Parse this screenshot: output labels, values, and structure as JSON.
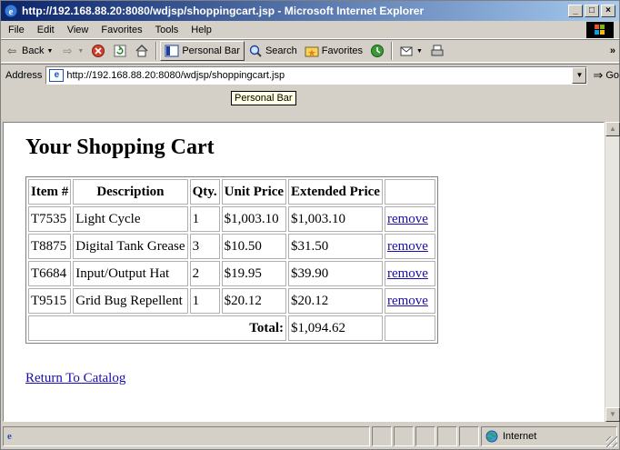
{
  "window": {
    "title": "http://192.168.88.20:8080/wdjsp/shoppingcart.jsp - Microsoft Internet Explorer",
    "controls": [
      "_",
      "□",
      "×"
    ]
  },
  "menu": [
    "File",
    "Edit",
    "View",
    "Favorites",
    "Tools",
    "Help"
  ],
  "toolbar": {
    "back": "Back",
    "personal_bar": "Personal Bar",
    "search": "Search",
    "favorites": "Favorites"
  },
  "address": {
    "label": "Address",
    "url": "http://192.168.88.20:8080/wdjsp/shoppingcart.jsp",
    "go": "Go"
  },
  "tooltip": "Personal Bar",
  "page": {
    "title": "Your Shopping Cart",
    "columns": [
      "Item #",
      "Description",
      "Qty.",
      "Unit Price",
      "Extended Price",
      ""
    ],
    "rows": [
      {
        "item": "T7535",
        "description": "Light Cycle",
        "qty": "1",
        "unit_price": "$1,003.10",
        "extended": "$1,003.10",
        "action": "remove"
      },
      {
        "item": "T8875",
        "description": "Digital Tank Grease",
        "qty": "3",
        "unit_price": "$10.50",
        "extended": "$31.50",
        "action": "remove"
      },
      {
        "item": "T6684",
        "description": "Input/Output Hat",
        "qty": "2",
        "unit_price": "$19.95",
        "extended": "$39.90",
        "action": "remove"
      },
      {
        "item": "T9515",
        "description": "Grid Bug Repellent",
        "qty": "1",
        "unit_price": "$20.12",
        "extended": "$20.12",
        "action": "remove"
      }
    ],
    "total_label": "Total:",
    "total_value": "$1,094.62",
    "return_link": "Return To Catalog"
  },
  "status": {
    "zone": "Internet"
  },
  "colors": {
    "title_start": "#0a246a",
    "title_end": "#a6caf0",
    "link": "#1a0dab"
  }
}
